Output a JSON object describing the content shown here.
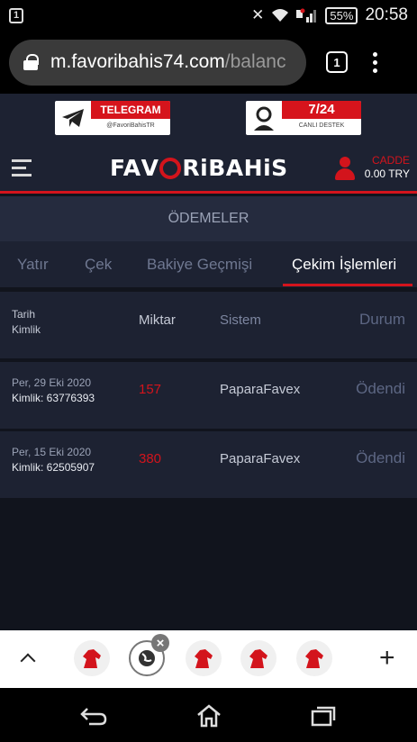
{
  "status_bar": {
    "sim": "1",
    "battery": "55%",
    "time": "20:58",
    "icons": [
      "mute-icon",
      "wifi-icon",
      "data-saver-icon",
      "signal-icon"
    ]
  },
  "browser": {
    "url_host": "m.favoribahis74.com",
    "url_path": "/balanc",
    "tab_count": "1"
  },
  "promos": {
    "telegram": {
      "title": "TELEGRAM",
      "sub": "@FavoriBahisTR"
    },
    "support": {
      "title": "7/24",
      "sub": "CANLI DESTEK"
    }
  },
  "header": {
    "logo": {
      "part1": "FA",
      "part2": "V",
      "part3": "RiBAHiS"
    },
    "user_name": "CADDE",
    "balance": "0.00 TRY"
  },
  "page_title": "ÖDEMELER",
  "tabs": [
    {
      "label": "Yatır"
    },
    {
      "label": "Çek"
    },
    {
      "label": "Bakiye Geçmişi"
    },
    {
      "label": "Çekim İşlemleri",
      "active": true
    }
  ],
  "table": {
    "headers": {
      "date": "Tarih",
      "id": "Kimlik",
      "amount": "Miktar",
      "system": "Sistem",
      "status": "Durum"
    },
    "rows": [
      {
        "date": "Per, 29 Eki 2020",
        "id": "Kimlik: 63776393",
        "amount": "157",
        "system": "PaparaFavex",
        "status": "Ödendi"
      },
      {
        "date": "Per, 15 Eki 2020",
        "id": "Kimlik: 62505907",
        "amount": "380",
        "system": "PaparaFavex",
        "status": "Ödendi"
      }
    ]
  },
  "colors": {
    "accent": "#d3141c",
    "panel": "#1d2232",
    "background": "#11141d"
  }
}
